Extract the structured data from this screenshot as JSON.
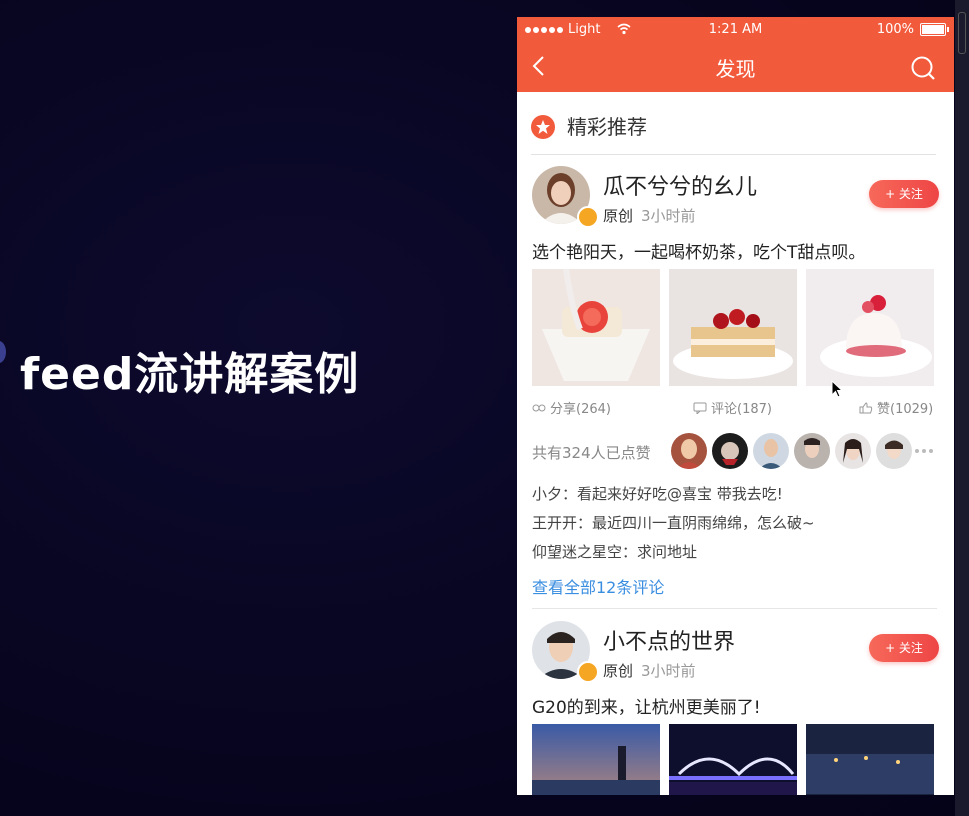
{
  "slide": {
    "title": "feed流讲解案例"
  },
  "status_bar": {
    "carrier": "Light",
    "time": "1:21 AM",
    "battery": "100%"
  },
  "navbar": {
    "title": "发现"
  },
  "section": {
    "title": "精彩推荐"
  },
  "posts": [
    {
      "username": "瓜不兮兮的幺儿",
      "original": "原创",
      "time": "3小时前",
      "follow": "+ 关注",
      "text": "选个艳阳天，一起喝杯奶茶，吃个T甜点呗。",
      "share": "分享(264)",
      "comment": "评论(187)",
      "like": "赞(1029)",
      "likes_summary": "共有324人已点赞",
      "comments": [
        "小夕：看起来好好吃@喜宝 带我去吃!",
        "王开开：最近四川一直阴雨绵绵，怎么破~",
        "仰望迷之星空：求问地址"
      ],
      "view_all": "查看全部12条评论"
    },
    {
      "username": "小不点的世界",
      "original": "原创",
      "time": "3小时前",
      "follow": "+ 关注",
      "text": "G20的到来，让杭州更美丽了!"
    }
  ],
  "colors": {
    "accent": "#f25a3c",
    "link": "#3a8ee0"
  }
}
